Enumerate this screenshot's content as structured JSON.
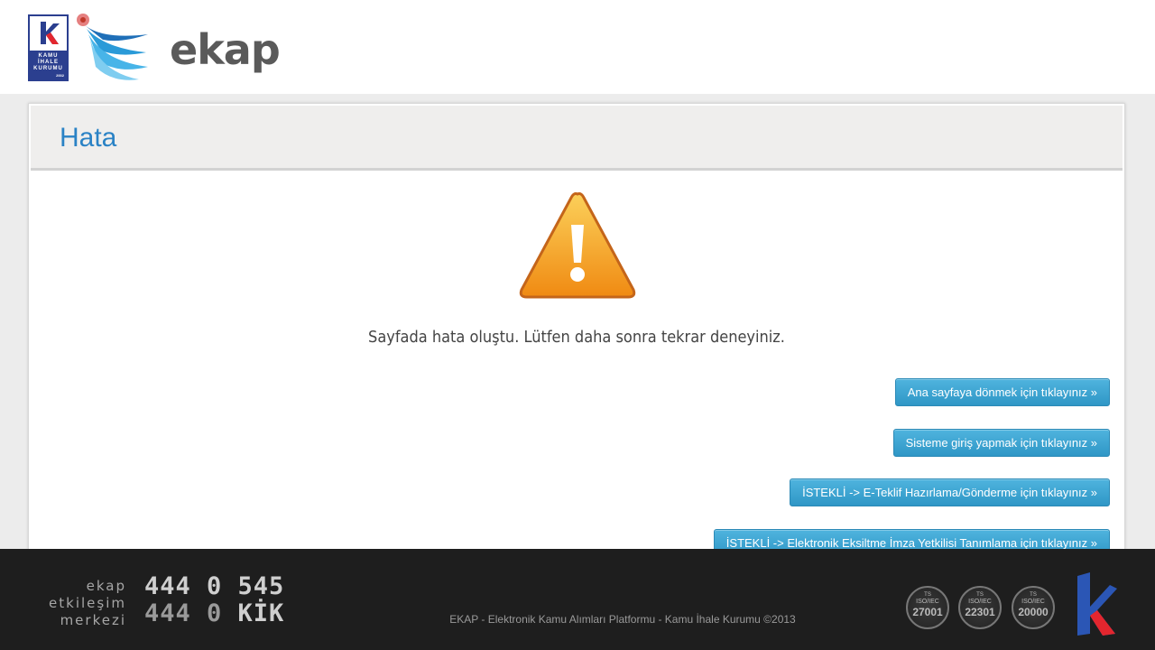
{
  "header": {
    "brand": "ekap",
    "kik_logo": {
      "letter": "k",
      "lines": [
        "KAMU",
        "İHALE",
        "KURUMU"
      ],
      "year": "2002"
    }
  },
  "panel": {
    "title": "Hata",
    "message": "Sayfada hata oluştu. Lütfen daha sonra tekrar deneyiniz.",
    "buttons": [
      "Ana sayfaya dönmek için tıklayınız »",
      "Sisteme giriş yapmak için tıklayınız »",
      "İSTEKLİ -> E-Teklif Hazırlama/Gönderme için tıklayınız »",
      "İSTEKLİ -> Elektronik Eksiltme İmza Yetkilisi Tanımlama için tıklayınız »"
    ]
  },
  "footer": {
    "etkilesim": [
      "ekap",
      "etkileşim",
      "merkezi"
    ],
    "phone1": "444 0 545",
    "phone2_prefix": "444 0 ",
    "phone2_suffix": "KİK",
    "copyright": "EKAP - Elektronik Kamu Alımları Platformu - Kamu İhale Kurumu ©2013",
    "certificates": [
      {
        "ts": "TS",
        "iso": "ISO/IEC",
        "num": "27001"
      },
      {
        "ts": "TS",
        "iso": "ISO/IEC",
        "num": "22301"
      },
      {
        "ts": "TS",
        "iso": "ISO/IEC",
        "num": "20000"
      }
    ]
  },
  "colors": {
    "title_blue": "#2a82c5",
    "button_blue": "#3aa3d2",
    "footer_bg": "#1e1e1e",
    "warning_orange": "#f29a1c"
  },
  "icons": [
    "kik-logo-icon",
    "ekap-bird-icon",
    "warning-triangle-icon",
    "kik-footer-logo-icon"
  ]
}
